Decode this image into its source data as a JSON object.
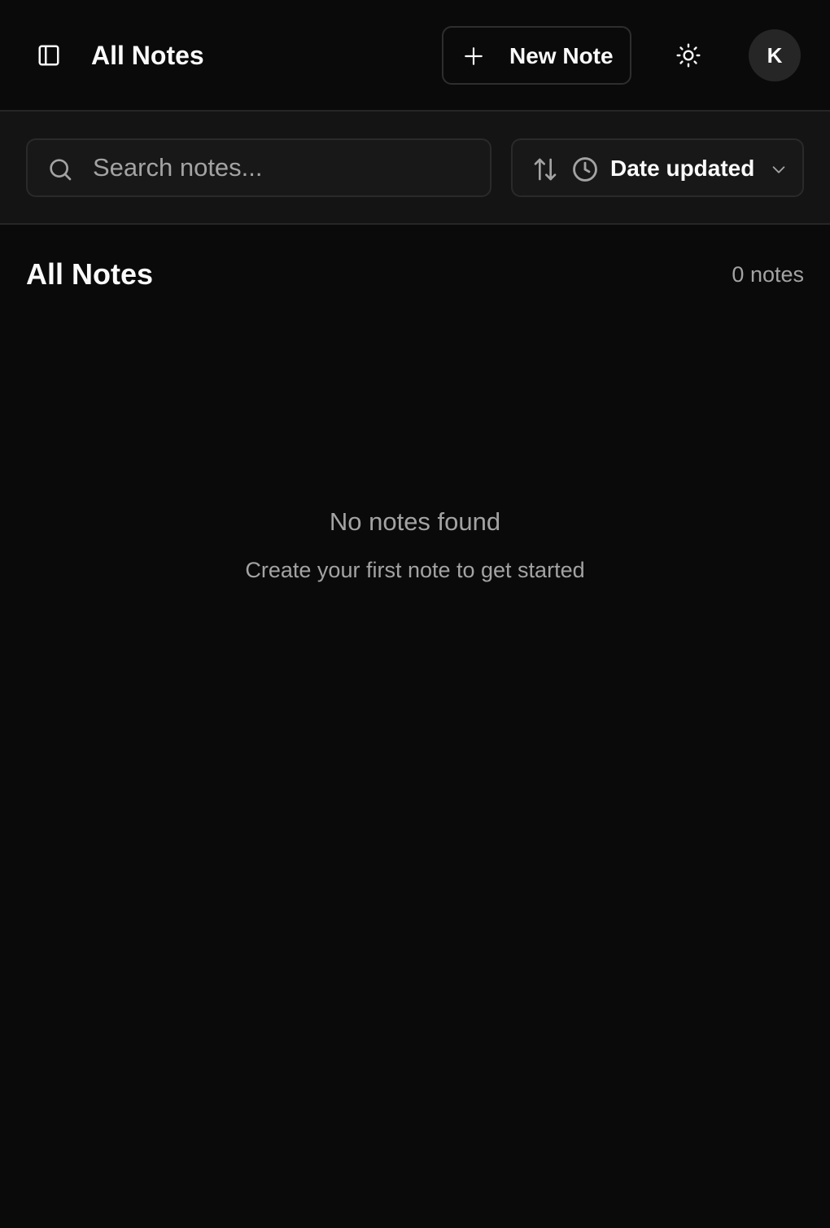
{
  "header": {
    "title": "All Notes",
    "new_note_label": "New Note",
    "avatar_initial": "K",
    "icons": [
      "panel-left-icon",
      "plus-icon",
      "sun-icon"
    ]
  },
  "toolbar": {
    "search": {
      "placeholder": "Search notes...",
      "value": ""
    },
    "sort": {
      "value": "Date updated",
      "icons": [
        "arrow-up-down-icon",
        "clock-icon",
        "chevron-down-icon"
      ]
    }
  },
  "main": {
    "section_title": "All Notes",
    "count_label": "0 notes",
    "empty_title": "No notes found",
    "empty_subtitle": "Create your first note to get started"
  },
  "colors": {
    "background": "#0a0a0a",
    "toolbar_background": "#141414",
    "border": "#262626",
    "text": "#fafafa",
    "muted_text": "#a3a3a3",
    "avatar_background": "#262626"
  }
}
